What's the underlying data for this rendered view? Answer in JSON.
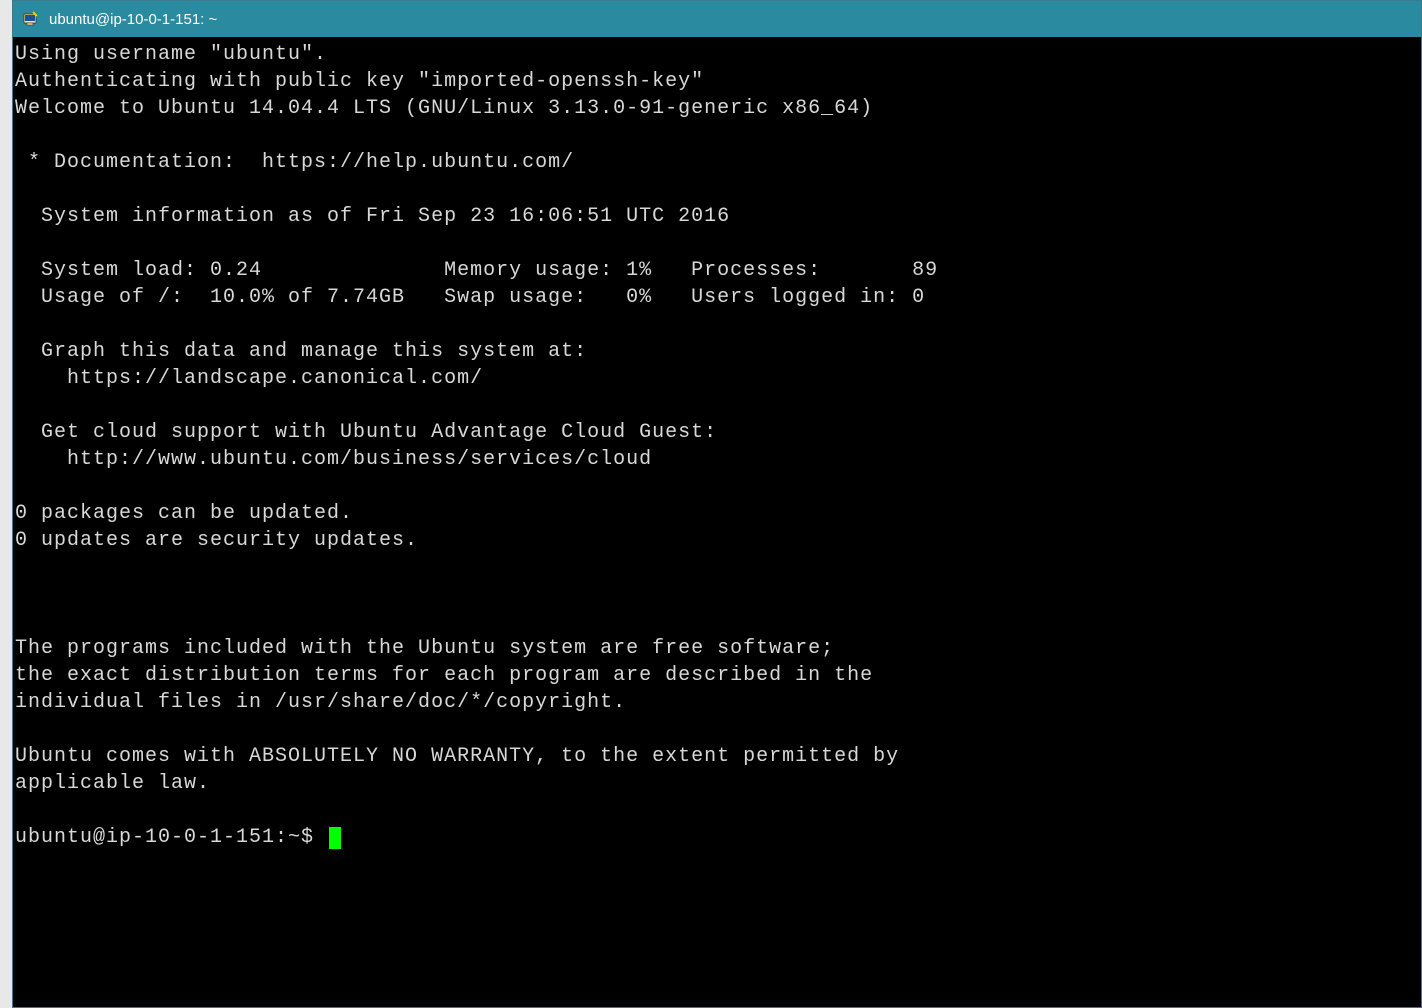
{
  "titlebar": {
    "title": "ubuntu@ip-10-0-1-151: ~"
  },
  "terminal": {
    "line1": "Using username \"ubuntu\".",
    "line2": "Authenticating with public key \"imported-openssh-key\"",
    "line3": "Welcome to Ubuntu 14.04.4 LTS (GNU/Linux 3.13.0-91-generic x86_64)",
    "line4": "",
    "line5": " * Documentation:  https://help.ubuntu.com/",
    "line6": "",
    "line7": "  System information as of Fri Sep 23 16:06:51 UTC 2016",
    "line8": "",
    "line9": "  System load: 0.24              Memory usage: 1%   Processes:       89",
    "line10": "  Usage of /:  10.0% of 7.74GB   Swap usage:   0%   Users logged in: 0",
    "line11": "",
    "line12": "  Graph this data and manage this system at:",
    "line13": "    https://landscape.canonical.com/",
    "line14": "",
    "line15": "  Get cloud support with Ubuntu Advantage Cloud Guest:",
    "line16": "    http://www.ubuntu.com/business/services/cloud",
    "line17": "",
    "line18": "0 packages can be updated.",
    "line19": "0 updates are security updates.",
    "line20": "",
    "line21": "",
    "line22": "",
    "line23": "The programs included with the Ubuntu system are free software;",
    "line24": "the exact distribution terms for each program are described in the",
    "line25": "individual files in /usr/share/doc/*/copyright.",
    "line26": "",
    "line27": "Ubuntu comes with ABSOLUTELY NO WARRANTY, to the extent permitted by",
    "line28": "applicable law.",
    "line29": "",
    "prompt": "ubuntu@ip-10-0-1-151:~$ "
  }
}
